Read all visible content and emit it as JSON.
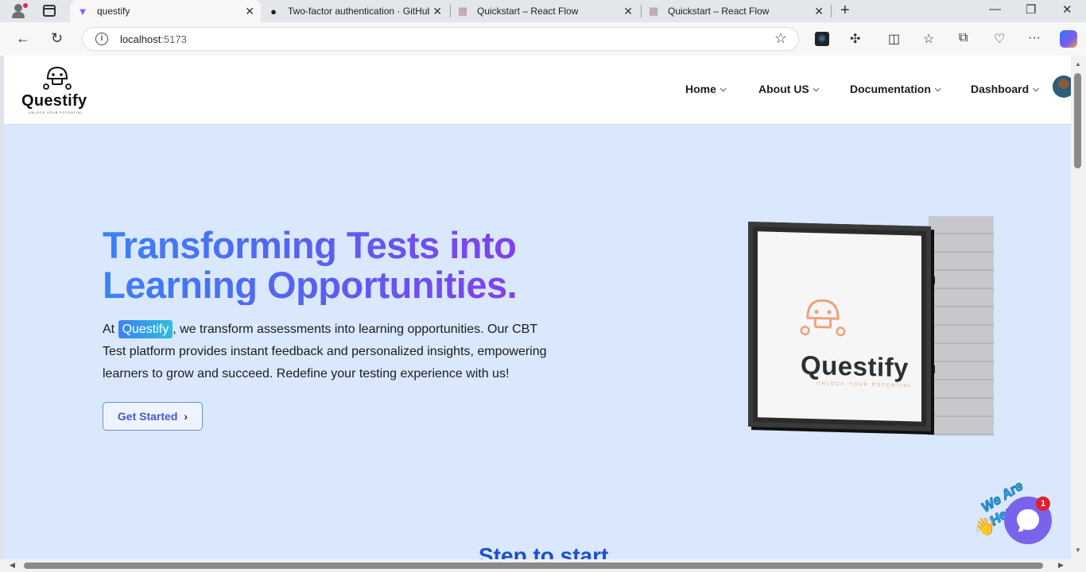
{
  "browser": {
    "tabs": [
      {
        "title": "questify",
        "favicon": "vite-icon",
        "active": true
      },
      {
        "title": "Two-factor authentication · GitHub",
        "favicon": "github-icon",
        "active": false
      },
      {
        "title": "Quickstart – React Flow",
        "favicon": "reactflow-icon",
        "active": false
      },
      {
        "title": "Quickstart – React Flow",
        "favicon": "reactflow-icon",
        "active": false
      }
    ],
    "url_host": "localhost",
    "url_port": ":5173"
  },
  "site": {
    "logo": {
      "name": "Questify",
      "tagline": "UNLOCK YOUR POTENTIAL"
    },
    "nav": [
      {
        "label": "Home"
      },
      {
        "label": "About US"
      },
      {
        "label": "Documentation"
      },
      {
        "label": "Dashboard"
      }
    ]
  },
  "hero": {
    "title_line1": "Transforming Tests into",
    "title_line2": "Learning Opportunities.",
    "para_prefix": "At ",
    "para_highlight": "Questify",
    "para_rest": ", we transform assessments into learning opportunities. Our CBT Test platform provides instant feedback and personalized insights, empowering learners to grow and succeed. Redefine your testing experience with us!",
    "cta_label": "Get Started"
  },
  "signboard": {
    "name": "Questify",
    "tagline": "UNLOCK YOUR POTENTIAL"
  },
  "steps": {
    "title": "Step to start"
  },
  "chat": {
    "teaser": "We Are Here!",
    "badge_count": "1"
  },
  "colors": {
    "accent_blue": "#3b82f6",
    "accent_purple": "#9333ea",
    "hero_bg": "#d9e8fd",
    "chat": "#7a63ec"
  }
}
